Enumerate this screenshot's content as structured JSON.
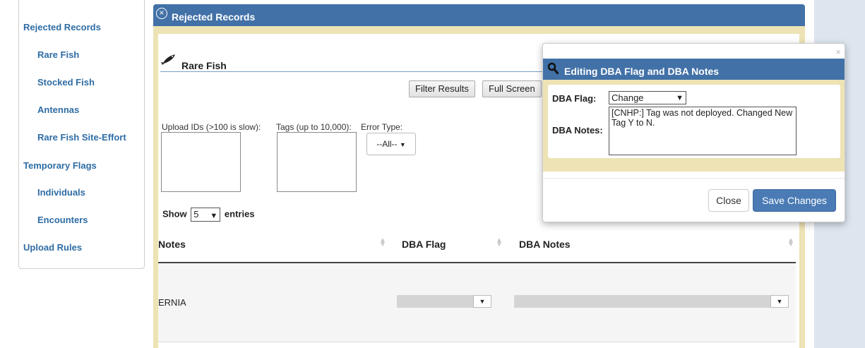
{
  "sidebar": {
    "items": [
      {
        "label": "Rejected Records",
        "level": "top"
      },
      {
        "label": "Rare Fish",
        "level": "sub"
      },
      {
        "label": "Stocked Fish",
        "level": "sub"
      },
      {
        "label": "Antennas",
        "level": "sub"
      },
      {
        "label": "Rare Fish Site-Effort",
        "level": "sub"
      },
      {
        "label": "Temporary Flags",
        "level": "top"
      },
      {
        "label": "Individuals",
        "level": "sub"
      },
      {
        "label": "Encounters",
        "level": "sub"
      },
      {
        "label": "Upload Rules",
        "level": "top"
      }
    ]
  },
  "main": {
    "title": "Rejected Records",
    "section_title": "Rare Fish",
    "buttons": {
      "filter": "Filter Results",
      "fullscreen": "Full Screen"
    },
    "filters": {
      "upload_ids_label": "Upload IDs (>100 is slow):",
      "tags_label": "Tags (up to 10,000):",
      "error_type_label": "Error Type:",
      "error_type_value": "--All--"
    },
    "show": {
      "prefix": "Show",
      "value": "5",
      "suffix": "entries"
    },
    "table": {
      "columns": [
        "Notes",
        "DBA Flag",
        "DBA Notes"
      ],
      "rows": [
        {
          "notes": "ERNIA"
        }
      ]
    }
  },
  "modal": {
    "title": "Editing DBA Flag and DBA Notes",
    "flag_label": "DBA Flag:",
    "flag_value": "Change",
    "notes_label": "DBA Notes:",
    "notes_value": "[CNHP:] Tag was not deployed. Changed New Tag Y to N.",
    "close_label": "Close",
    "save_label": "Save Changes",
    "dismiss_glyph": "×"
  },
  "colors": {
    "header_blue": "#4271a7",
    "panel_tan": "#ede3b4",
    "link_blue": "#2e6ca4",
    "save_button": "#4a7bb5"
  }
}
